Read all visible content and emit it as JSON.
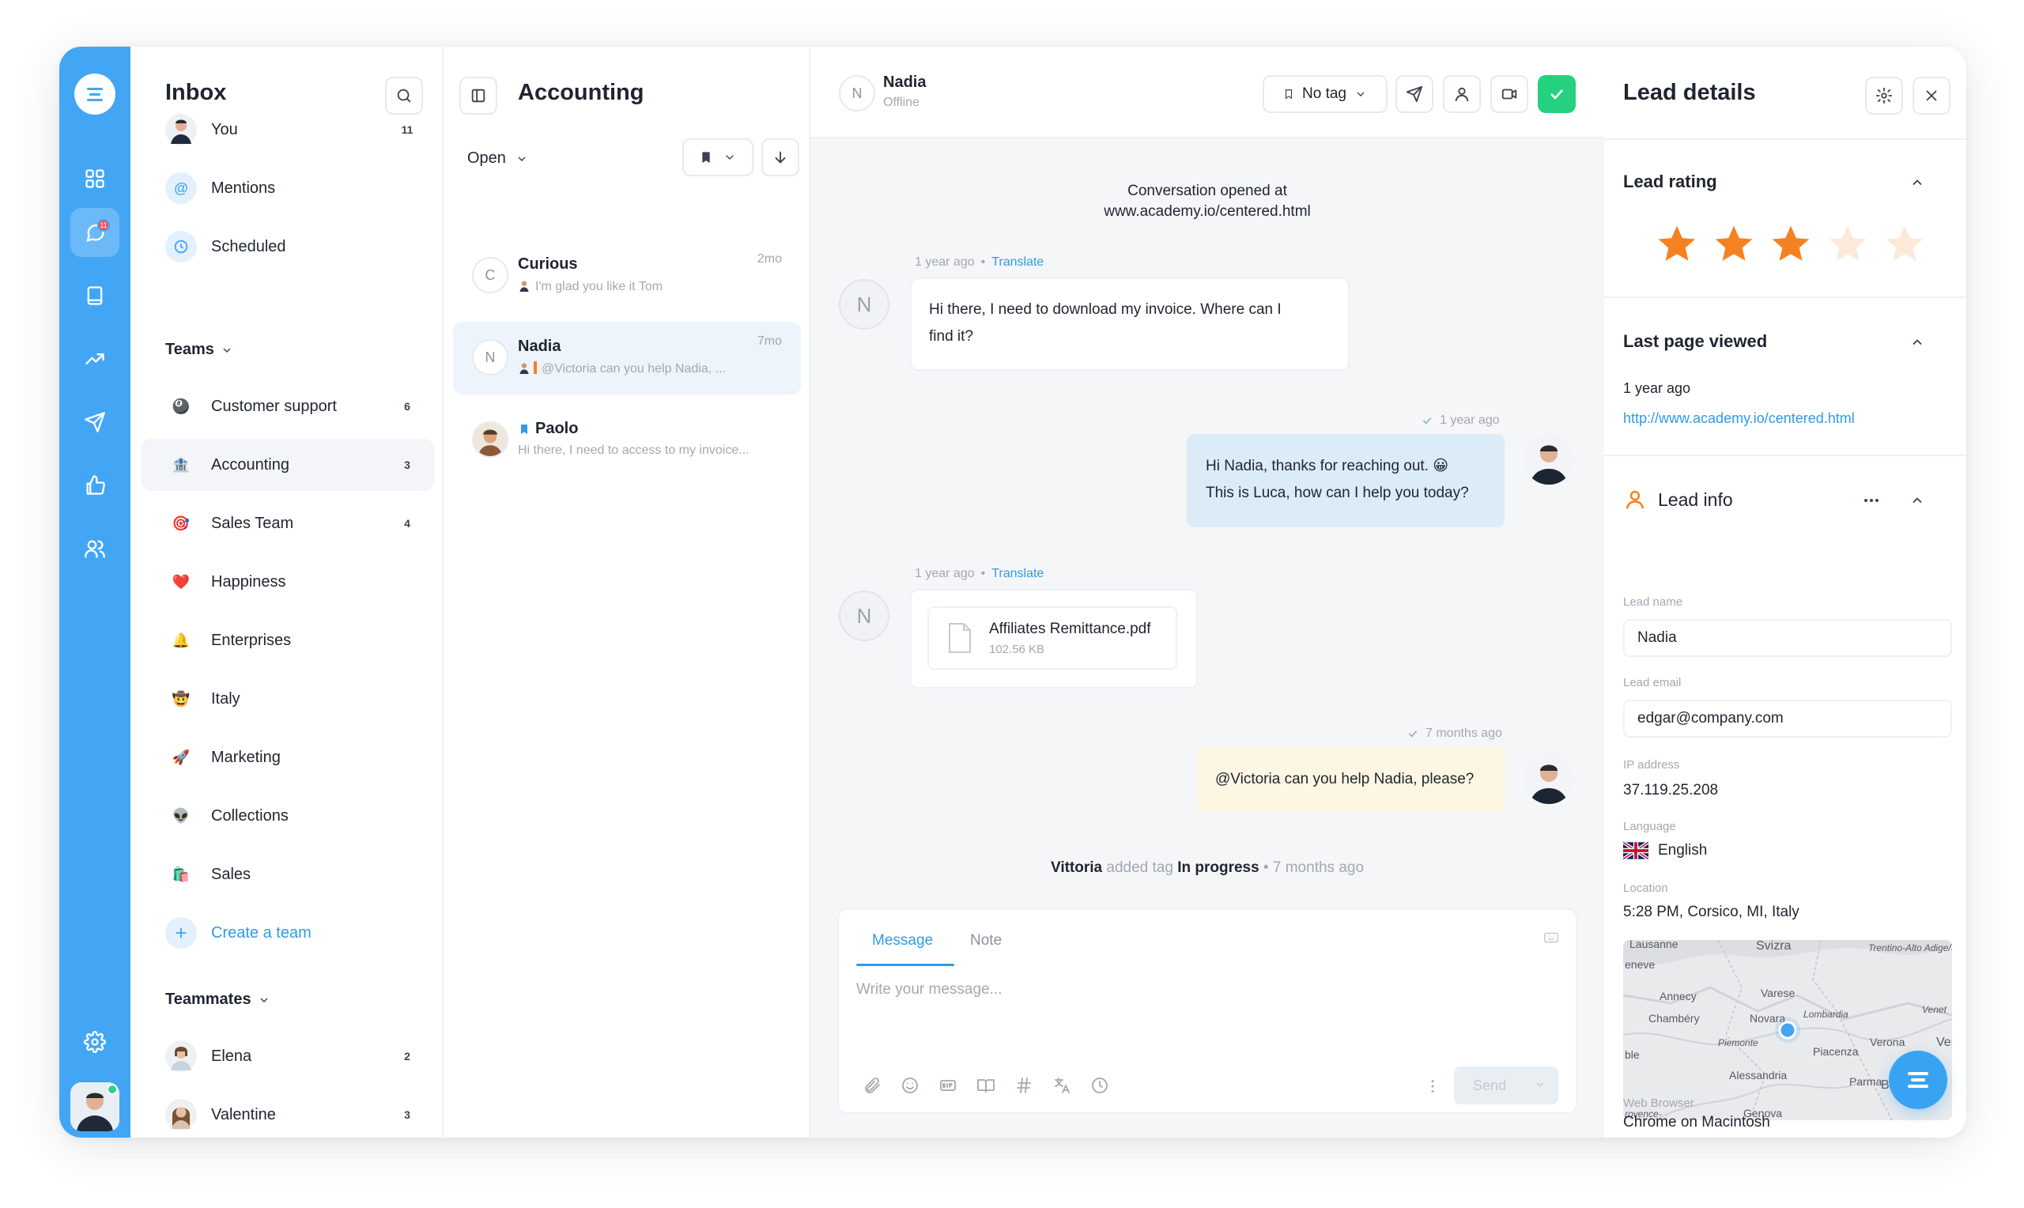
{
  "colors": {
    "accent": "#42a6f5",
    "link": "#2f9be8",
    "success": "#25d17f",
    "badge": "#ff4d5e",
    "star": "#f58220",
    "star_empty": "#fde9d8"
  },
  "rail": {
    "icons": [
      "logo-icon",
      "grid-icon",
      "inbox-chat-icon",
      "book-icon",
      "trending-icon",
      "send-icon",
      "thumbs-up-icon",
      "users-icon",
      "settings-icon"
    ],
    "inbox_badge": "11"
  },
  "inbox": {
    "title": "Inbox",
    "items": [
      {
        "label": "You",
        "count": "11",
        "icon": "avatar"
      },
      {
        "label": "Mentions",
        "count": "",
        "icon": "at-icon"
      },
      {
        "label": "Scheduled",
        "count": "",
        "icon": "clock-icon"
      }
    ],
    "teams_header": "Teams",
    "teams": [
      {
        "label": "Customer support",
        "count": "6",
        "emoji": "🎱"
      },
      {
        "label": "Accounting",
        "count": "3",
        "emoji": "🏦"
      },
      {
        "label": "Sales Team",
        "count": "4",
        "emoji": "🎯"
      },
      {
        "label": "Happiness",
        "count": "",
        "emoji": "❤️"
      },
      {
        "label": "Enterprises",
        "count": "",
        "emoji": "🔔"
      },
      {
        "label": "Italy",
        "count": "",
        "emoji": "🤠"
      },
      {
        "label": "Marketing",
        "count": "",
        "emoji": "🚀"
      },
      {
        "label": "Collections",
        "count": "",
        "emoji": "👽"
      },
      {
        "label": "Sales",
        "count": "",
        "emoji": "🛍️"
      }
    ],
    "create_team": "Create a team",
    "teammates_header": "Teammates",
    "teammates": [
      {
        "label": "Elena",
        "count": "2"
      },
      {
        "label": "Valentine",
        "count": "3"
      }
    ]
  },
  "conversations": {
    "title": "Accounting",
    "filter": "Open",
    "list": [
      {
        "initial": "C",
        "name": "Curious",
        "time": "2mo",
        "preview": "I'm glad you like it Tom"
      },
      {
        "initial": "N",
        "name": "Nadia",
        "time": "7mo",
        "preview": "@Victoria can you help Nadia, ..."
      },
      {
        "initial": "",
        "name": "Paolo",
        "time": "",
        "preview": "Hi there, I need to access to my invoice..."
      }
    ]
  },
  "chat": {
    "contact_initial": "N",
    "contact_name": "Nadia",
    "contact_status": "Offline",
    "tag_label": "No tag",
    "opened_title": "Conversation opened at",
    "opened_url": "www.academy.io/centered.html",
    "msg1": {
      "time": "1 year ago",
      "translate": "Translate",
      "line1": "Hi there, I need to download my invoice. Where can I",
      "line2": "find it?"
    },
    "msg2": {
      "time": "1 year ago",
      "line1": "Hi Nadia, thanks for reaching out. 😀",
      "line2": "This is Luca, how can I help you today?"
    },
    "msg3": {
      "time": "1 year ago",
      "translate": "Translate",
      "file_name": "Affiliates Remittance.pdf",
      "file_size": "102.56 KB"
    },
    "msg4": {
      "time": "7 months ago",
      "text": "@Victoria can you help Nadia, please?"
    },
    "activity": {
      "actor": "Vittoria",
      "action": "added tag",
      "tag": "In progress",
      "time": "• 7 months ago"
    },
    "composer": {
      "tab_message": "Message",
      "tab_note": "Note",
      "placeholder": "Write your message...",
      "send": "Send"
    }
  },
  "lead": {
    "title": "Lead details",
    "rating_header": "Lead rating",
    "rating": 3,
    "rating_max": 5,
    "last_page_header": "Last page viewed",
    "last_page_time": "1 year ago",
    "last_page_url": "http://www.academy.io/centered.html",
    "info_header": "Lead info",
    "name_label": "Lead name",
    "name_value": "Nadia",
    "email_label": "Lead email",
    "email_value": "edgar@company.com",
    "ip_label": "IP address",
    "ip_value": "37.119.25.208",
    "language_label": "Language",
    "language_value": "English",
    "location_label": "Location",
    "location_value": "5:28 PM, Corsico, MI, Italy",
    "browser_label": "Web Browser",
    "browser_value": "Chrome on Macintosh",
    "map_labels": [
      "Lausanne",
      "Svizra",
      "Trentino-Alto Adige/Südtirol",
      "eneve",
      "Varese",
      "Annecy",
      "Lombardia",
      "Chambéry",
      "Novara",
      "Venet",
      "Piemonte",
      "Verona",
      "Ven",
      "ble",
      "Piacenza",
      "Alessandria",
      "Parma",
      "Bologna",
      "rovence-",
      "Genova"
    ]
  }
}
